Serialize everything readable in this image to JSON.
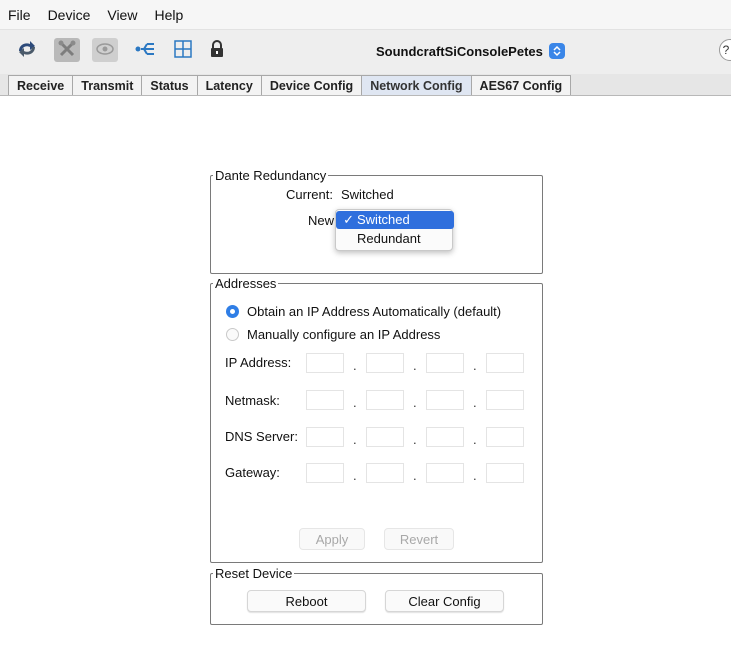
{
  "menu": [
    "File",
    "Device",
    "View",
    "Help"
  ],
  "toolbar": {
    "icons": [
      "sync-icon",
      "tools-icon",
      "eye-icon",
      "network-port-icon",
      "grid-icon",
      "padlock-icon"
    ],
    "device_name": "SoundcraftSiConsolePetes"
  },
  "tabs": [
    "Receive",
    "Transmit",
    "Status",
    "Latency",
    "Device Config",
    "Network Config",
    "AES67 Config"
  ],
  "active_tab": "Network Config",
  "redundancy": {
    "legend": "Dante Redundancy",
    "current_label": "Current:",
    "current_value": "Switched",
    "new_label": "New",
    "options": [
      "Switched",
      "Redundant"
    ],
    "selected": "Switched",
    "check_mark": "✓"
  },
  "addresses": {
    "legend": "Addresses",
    "auto_label": "Obtain an IP Address Automatically (default)",
    "manual_label": "Manually configure an IP Address",
    "selected_mode": "auto",
    "fields": [
      {
        "label": "IP Address:",
        "octets": [
          "",
          "",
          "",
          ""
        ]
      },
      {
        "label": "Netmask:",
        "octets": [
          "",
          "",
          "",
          ""
        ]
      },
      {
        "label": "DNS Server:",
        "octets": [
          "",
          "",
          "",
          ""
        ]
      },
      {
        "label": "Gateway:",
        "octets": [
          "",
          "",
          "",
          ""
        ]
      }
    ],
    "apply_label": "Apply",
    "revert_label": "Revert"
  },
  "reset": {
    "legend": "Reset Device",
    "reboot_label": "Reboot",
    "clear_label": "Clear Config"
  },
  "colors": {
    "accent": "#2f6fdd",
    "radio_on": "#2f7ee6",
    "tab_active_bg": "#dfe6f2"
  }
}
